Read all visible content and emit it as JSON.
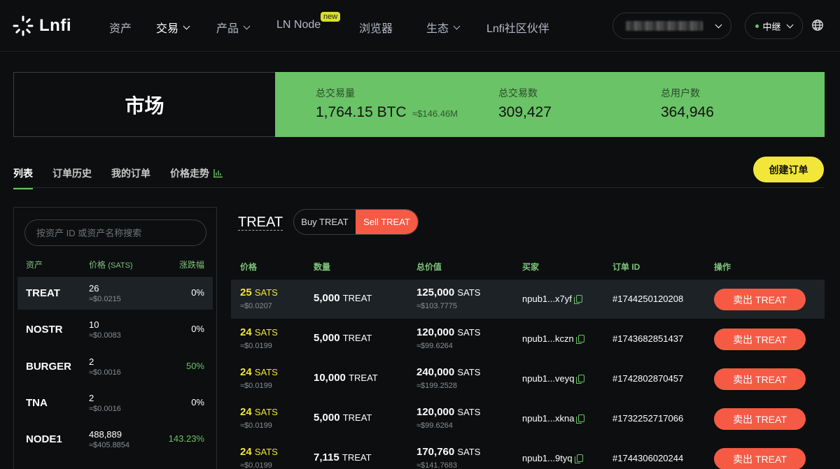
{
  "brand": {
    "name": "Lnfi"
  },
  "nav": {
    "items": [
      {
        "label": "资产",
        "dropdown": false
      },
      {
        "label": "交易",
        "dropdown": true
      },
      {
        "label": "产品",
        "dropdown": true
      },
      {
        "label": "LN Node",
        "badge": "new"
      },
      {
        "label": "浏览器",
        "dropdown": false
      },
      {
        "label": "生态",
        "dropdown": true
      },
      {
        "label": "Lnfi社区伙伴",
        "dropdown": false
      }
    ],
    "relay_label": "中继"
  },
  "banner": {
    "title": "市场",
    "stats": [
      {
        "label": "总交易量",
        "value": "1,764.15 BTC",
        "sub": "≈$146.46M"
      },
      {
        "label": "总交易数",
        "value": "309,427"
      },
      {
        "label": "总用户数",
        "value": "364,946"
      }
    ],
    "accent_color": "#6ac366"
  },
  "tabs": [
    "列表",
    "订单历史",
    "我的订单",
    "价格走势"
  ],
  "create_order_label": "创建订单",
  "asset_panel": {
    "search_placeholder": "按资产 ID 或资产名称搜索",
    "headers": {
      "asset": "资产",
      "price": "价格",
      "price_unit": "(SATS)",
      "change": "涨跌幅"
    },
    "assets": [
      {
        "name": "TREAT",
        "price": "26",
        "usd": "≈$0.0215",
        "change": "0%"
      },
      {
        "name": "NOSTR",
        "price": "10",
        "usd": "≈$0.0083",
        "change": "0%"
      },
      {
        "name": "BURGER",
        "price": "2",
        "usd": "≈$0.0016",
        "change": "50%"
      },
      {
        "name": "TNA",
        "price": "2",
        "usd": "≈$0.0016",
        "change": "0%"
      },
      {
        "name": "NODE1",
        "price": "488,889",
        "usd": "≈$405.8854",
        "change": "143.23%"
      }
    ]
  },
  "orderbook": {
    "ticker": "TREAT",
    "buy_label": "Buy TREAT",
    "sell_label": "Sell TREAT",
    "headers": {
      "price": "价格",
      "qty": "数量",
      "total": "总价值",
      "buyer": "买家",
      "order_id": "订单 ID",
      "action": "操作"
    },
    "orders": [
      {
        "price": "25",
        "price_unit": "SATS",
        "price_usd": "≈$0.0207",
        "qty": "5,000",
        "qty_unit": "TREAT",
        "total": "125,000",
        "total_unit": "SATS",
        "total_usd": "≈$103.7775",
        "buyer": "npub1...x7yf",
        "order_id": "#1744250120208",
        "action": "卖出 TREAT"
      },
      {
        "price": "24",
        "price_unit": "SATS",
        "price_usd": "≈$0.0199",
        "qty": "5,000",
        "qty_unit": "TREAT",
        "total": "120,000",
        "total_unit": "SATS",
        "total_usd": "≈$99.6264",
        "buyer": "npub1...kczn",
        "order_id": "#1743682851437",
        "action": "卖出 TREAT"
      },
      {
        "price": "24",
        "price_unit": "SATS",
        "price_usd": "≈$0.0199",
        "qty": "10,000",
        "qty_unit": "TREAT",
        "total": "240,000",
        "total_unit": "SATS",
        "total_usd": "≈$199.2528",
        "buyer": "npub1...veyq",
        "order_id": "#1742802870457",
        "action": "卖出 TREAT"
      },
      {
        "price": "24",
        "price_unit": "SATS",
        "price_usd": "≈$0.0199",
        "qty": "5,000",
        "qty_unit": "TREAT",
        "total": "120,000",
        "total_unit": "SATS",
        "total_usd": "≈$99.6264",
        "buyer": "npub1...xkna",
        "order_id": "#1732252717066",
        "action": "卖出 TREAT"
      },
      {
        "price": "24",
        "price_unit": "SATS",
        "price_usd": "≈$0.0199",
        "qty": "7,115",
        "qty_unit": "TREAT",
        "total": "170,760",
        "total_unit": "SATS",
        "total_usd": "≈$141.7683",
        "buyer": "npub1...9tyq",
        "order_id": "#1744306020244",
        "action": "卖出 TREAT"
      }
    ]
  },
  "colors": {
    "sell": "#f55a45",
    "price": "#f2e63a",
    "create": "#f2e63a",
    "positive": "#6ac366"
  }
}
